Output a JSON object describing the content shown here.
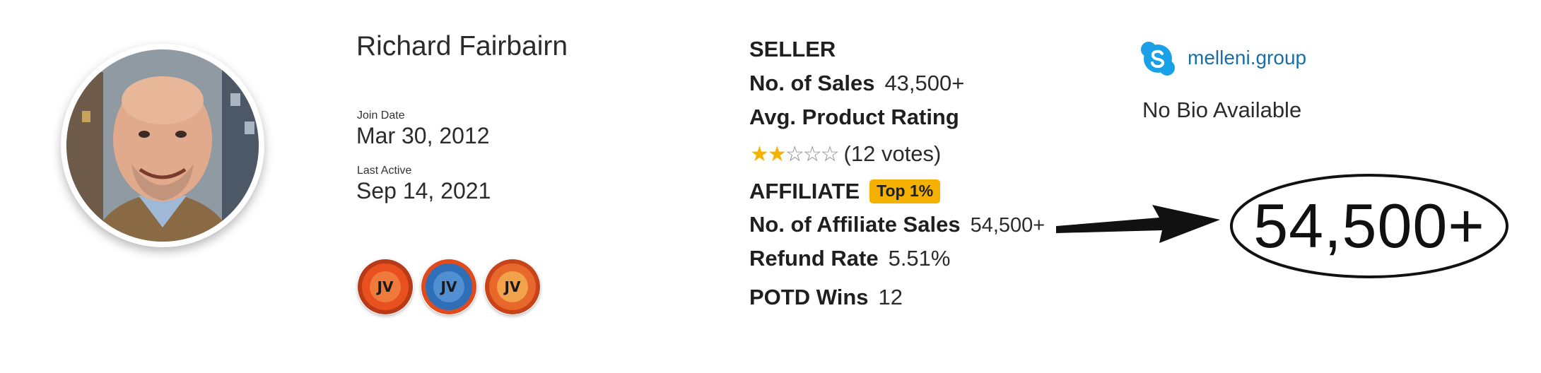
{
  "profile": {
    "name": "Richard Fairbairn",
    "join_date_label": "Join Date",
    "join_date": "Mar 30, 2012",
    "last_active_label": "Last Active",
    "last_active": "Sep 14, 2021",
    "badges": [
      {
        "icon": "jvzoo-premium-seller-badge",
        "color": "#e8511f"
      },
      {
        "icon": "jvzoo-premium-affiliate-badge",
        "color": "#2f6fb8"
      },
      {
        "icon": "jvzoo-high-performance-badge",
        "color": "#e8672a"
      }
    ]
  },
  "seller": {
    "heading": "SELLER",
    "sales_label": "No. of Sales",
    "sales_value": "43,500+",
    "rating_label": "Avg. Product Rating",
    "rating_stars_filled": 2,
    "rating_stars_total": 5,
    "rating_votes": "(12 votes)"
  },
  "affiliate": {
    "heading": "AFFILIATE",
    "rank_badge": "Top 1%",
    "sales_label": "No. of Affiliate Sales",
    "sales_value": "54,500+",
    "refund_label": "Refund Rate",
    "refund_value": "5.51%",
    "potd_label": "POTD Wins",
    "potd_value": "12"
  },
  "contact": {
    "icon": "skype-icon",
    "handle": "melleni.group",
    "bio": "No Bio Available"
  },
  "annotation": {
    "highlight_text": "54,500+"
  },
  "colors": {
    "star": "#f5b301",
    "top_badge": "#f5b000",
    "link": "#1a6ea8",
    "skype": "#1aa0e6"
  }
}
